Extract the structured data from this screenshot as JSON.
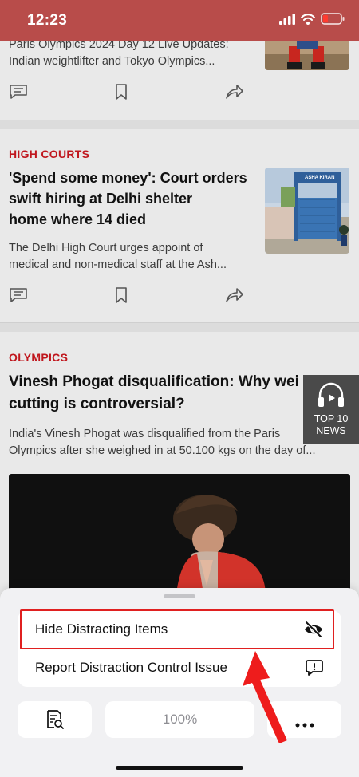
{
  "status_bar": {
    "time": "12:23"
  },
  "articles": [
    {
      "title": "Paris Olympics 2024 Day 12 Live Updates: Indian weightlifter and Tokyo Olympics..."
    },
    {
      "category": "HIGH COURTS",
      "title_lines": [
        "'Spend some money': Court orders",
        "swift hiring at Delhi shelter",
        "home where 14 died"
      ],
      "summary_lines": [
        "The Delhi High Court urges appoint of",
        "medical and non-medical staff at the Ash..."
      ],
      "image_sign": "ASHA KIRAN"
    },
    {
      "category": "OLYMPICS",
      "title_lines": [
        "Vinesh Phogat disqualification: Why wei",
        "cutting is controversial?"
      ],
      "summary_lines": [
        "India's Vinesh Phogat was disqualified from the Paris",
        "Olympics after she weighed in at 50.100 kgs on the day of..."
      ]
    }
  ],
  "top10": {
    "line1": "TOP 10",
    "line2": "NEWS"
  },
  "sheet": {
    "menu": [
      {
        "label": "Hide Distracting Items",
        "icon": "eye-slash-icon",
        "highlighted": true
      },
      {
        "label": "Report Distraction Control Issue",
        "icon": "report-bubble-icon"
      }
    ],
    "zoom": "100%"
  },
  "colors": {
    "status_bar": "#b84c4a",
    "category": "#c0161d",
    "highlight": "#e02020"
  }
}
